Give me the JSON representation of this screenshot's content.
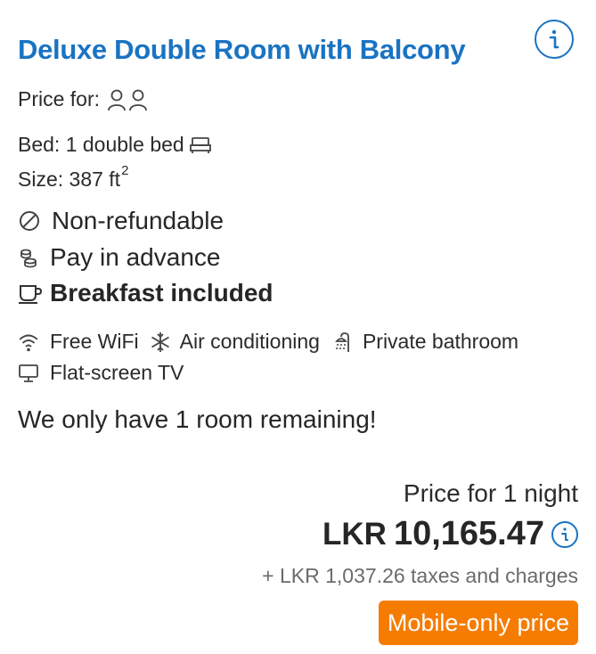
{
  "room": {
    "title": "Deluxe Double Room with Balcony",
    "price_for_label": "Price for:",
    "bed": "Bed: 1 double bed",
    "size_prefix": "Size: 387 ft",
    "size_sup": "2"
  },
  "policies": {
    "refund": "Non-refundable",
    "payment": "Pay in advance",
    "meal": "Breakfast included"
  },
  "facilities": {
    "wifi": "Free WiFi",
    "ac": "Air conditioning",
    "bathroom": "Private bathroom",
    "tv": "Flat-screen TV"
  },
  "availability": "We only have 1 room remaining!",
  "pricing": {
    "nights_label": "Price for 1 night",
    "currency": "LKR",
    "amount": "10,165.47",
    "taxes": "+ LKR 1,037.26 taxes and charges",
    "badge": "Mobile-only price"
  },
  "colors": {
    "accent": "#1a73c2",
    "badge": "#f57c00",
    "text": "#262626"
  },
  "icons": [
    "info-icon",
    "person-icon",
    "bed-icon",
    "no-sign-icon",
    "coins-icon",
    "cup-icon",
    "wifi-icon",
    "snowflake-icon",
    "shower-icon",
    "monitor-icon"
  ]
}
